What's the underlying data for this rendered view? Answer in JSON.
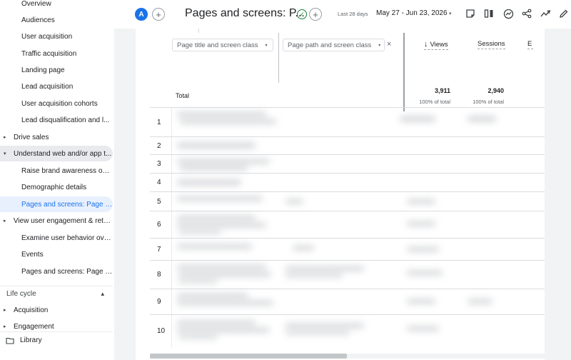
{
  "sidebar": {
    "items": [
      {
        "label": "Overview",
        "kind": "child",
        "state": ""
      },
      {
        "label": "Audiences",
        "kind": "child",
        "state": ""
      },
      {
        "label": "User acquisition",
        "kind": "child",
        "state": ""
      },
      {
        "label": "Traffic acquisition",
        "kind": "child",
        "state": ""
      },
      {
        "label": "Landing page",
        "kind": "child",
        "state": ""
      },
      {
        "label": "Lead acquisition",
        "kind": "child",
        "state": ""
      },
      {
        "label": "User acquisition cohorts",
        "kind": "child",
        "state": ""
      },
      {
        "label": "Lead disqualification and l...",
        "kind": "child",
        "state": ""
      },
      {
        "label": "Drive sales",
        "kind": "group",
        "arrow": "▸",
        "state": ""
      },
      {
        "label": "Understand web and/or app t...",
        "kind": "group",
        "arrow": "▾",
        "state": "hl"
      },
      {
        "label": "Raise brand awareness ove...",
        "kind": "child",
        "state": ""
      },
      {
        "label": "Demographic details",
        "kind": "child",
        "state": ""
      },
      {
        "label": "Pages and screens: Page p...",
        "kind": "child",
        "state": "active"
      },
      {
        "label": "View user engagement & rete...",
        "kind": "group",
        "arrow": "▸",
        "state": ""
      },
      {
        "label": "Examine user behavior ove...",
        "kind": "child",
        "state": ""
      },
      {
        "label": "Events",
        "kind": "child",
        "state": ""
      },
      {
        "label": "Pages and screens: Page p...",
        "kind": "child",
        "state": ""
      }
    ],
    "lifecycle": {
      "label": "Life cycle",
      "chevron": "▴"
    },
    "lifecycle_items": [
      {
        "label": "Acquisition",
        "arrow": "▸"
      },
      {
        "label": "Engagement",
        "arrow": "▸"
      }
    ],
    "library_label": "Library"
  },
  "header": {
    "avatar_letter": "A",
    "add_symbol": "+",
    "title": "Pages and screens: P...",
    "check_symbol": "✓",
    "date_label": "Last 28 days",
    "date_range": "May 27 - Jun 23, 2026",
    "dropdown_symbol": "▾",
    "tool_icons": [
      "notes-icon",
      "compare-columns-icon",
      "insights-icon",
      "share-icon",
      "trend-icon",
      "edit-icon"
    ]
  },
  "table": {
    "dimension_1": "Page title and screen class",
    "dimension_2": "Page path and screen class",
    "close_symbol": "×",
    "sort_symbol": "↓",
    "metric_1": "Views",
    "metric_2": "Sessions",
    "metric_3": "E",
    "total_label": "Total",
    "total_views": "3,911",
    "total_views_pct": "100% of total",
    "total_sessions": "2,940",
    "total_sessions_pct": "100% of total",
    "row_numbers": [
      "1",
      "2",
      "3",
      "4",
      "5",
      "6",
      "7",
      "8",
      "9",
      "10"
    ]
  },
  "colors": {
    "accent": "#1a73e8",
    "active_bg": "#e8f0fe",
    "success": "#188038"
  }
}
